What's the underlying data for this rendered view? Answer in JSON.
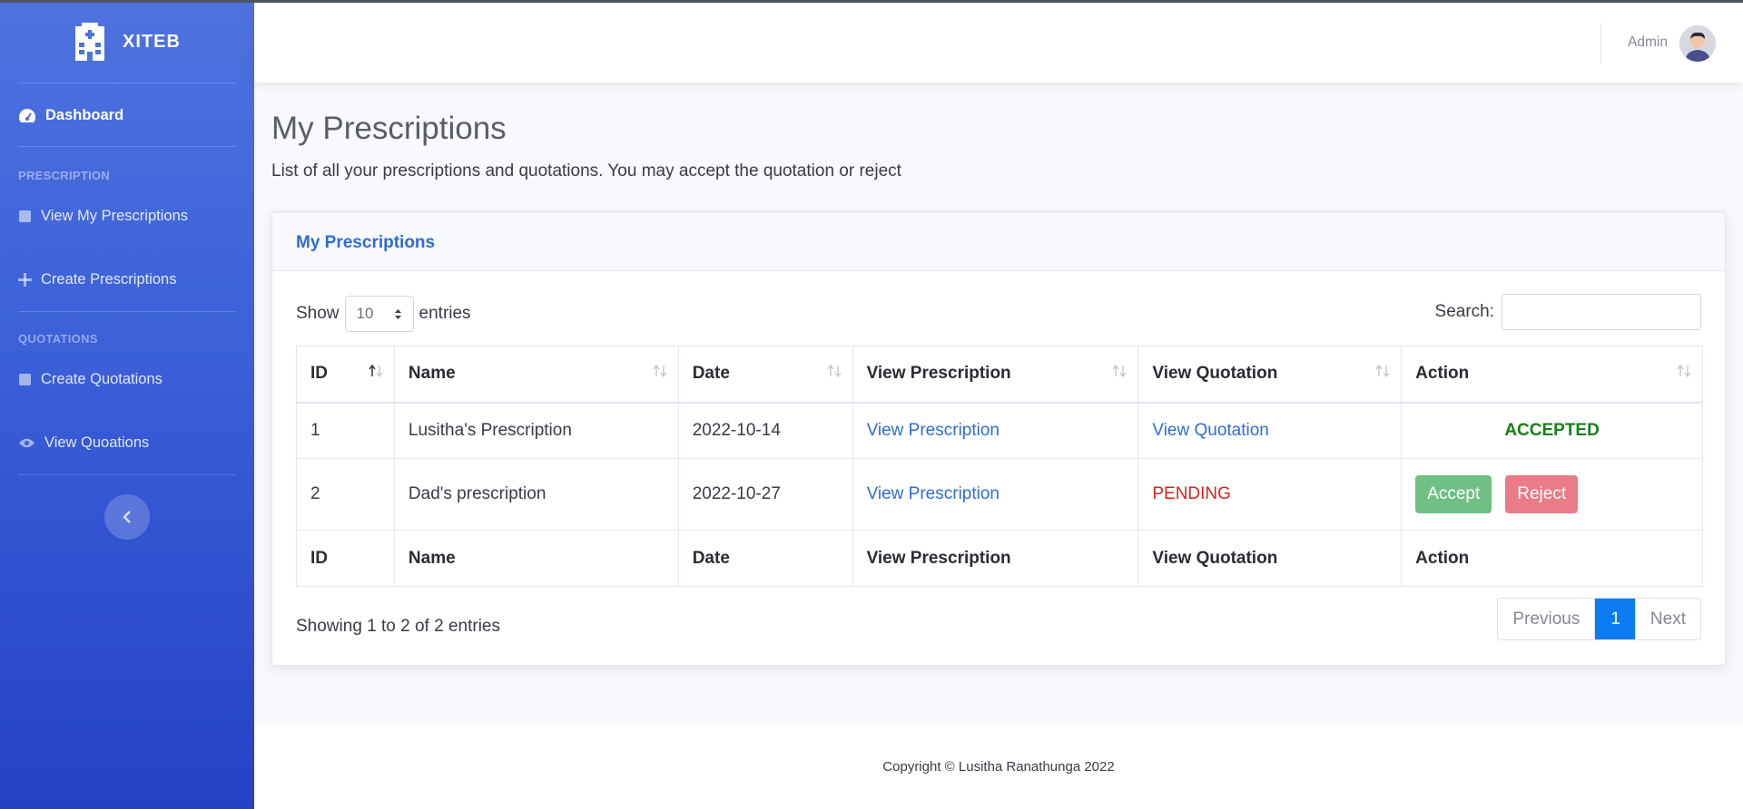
{
  "brand": {
    "name": "XITEB",
    "icon": "hospital-icon"
  },
  "sidebar": {
    "dashboard": "Dashboard",
    "heading_prescription": "PRESCRIPTION",
    "view_my_prescriptions": "View My Prescriptions",
    "create_prescriptions": "Create Prescriptions",
    "heading_quotations": "QUOTATIONS",
    "create_quotations": "Create Quotations",
    "view_quotations": "View Quoations"
  },
  "topbar": {
    "user_name": "Admin"
  },
  "page": {
    "title": "My Prescriptions",
    "description": "List of all your prescriptions and quotations. You may accept the quotation or reject"
  },
  "card": {
    "title": "My Prescriptions",
    "show_label": "Show",
    "entries_value": "10",
    "entries_label": "entries",
    "search_label": "Search:",
    "search_value": ""
  },
  "table": {
    "columns": [
      "ID",
      "Name",
      "Date",
      "View Prescription",
      "View Quotation",
      "Action"
    ],
    "rows": [
      {
        "id": "1",
        "name": "Lusitha's Prescription",
        "date": "2022-10-14",
        "prescription": "View Prescription",
        "quotation": "View Quotation",
        "action_status": "ACCEPTED"
      },
      {
        "id": "2",
        "name": "Dad's prescription",
        "date": "2022-10-27",
        "prescription": "View Prescription",
        "quotation": "PENDING",
        "accept": "Accept",
        "reject": "Reject"
      }
    ]
  },
  "info": "Showing 1 to 2 of 2 entries",
  "pagination": {
    "previous": "Previous",
    "current": "1",
    "next": "Next"
  },
  "footer": {
    "copyright": "Copyright © Lusitha Ranathunga 2022"
  },
  "colors": {
    "sidebar": "#4e73df",
    "primary": "#2e6cd6",
    "accept": "#70c086",
    "reject": "#e97c86",
    "pending": "#d9241e",
    "accepted": "#1a7d1a"
  }
}
